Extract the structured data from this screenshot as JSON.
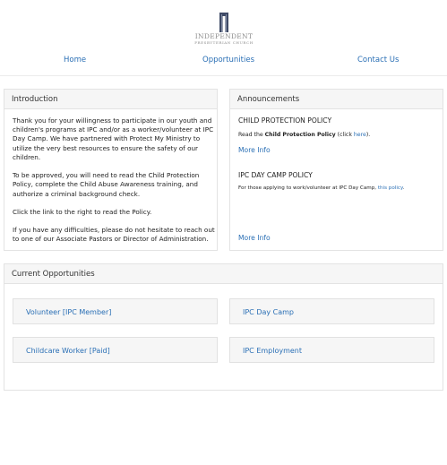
{
  "logo": {
    "name": "INDEPENDENT",
    "subtitle": "PRESBYTERIAN CHURCH",
    "icon": "church-tower-icon"
  },
  "nav": {
    "home": "Home",
    "opportunities": "Opportunities",
    "contact": "Contact Us"
  },
  "introduction": {
    "heading": "Introduction",
    "paragraphs": [
      "Thank you for your willingness to participate in our youth and children's programs at IPC and/or as a worker/volunteer at IPC Day Camp. We have partnered with Protect My Ministry to utilize the very best resources to ensure the safety of our children.",
      "To be approved, you will need to read the Child Protection Policy, complete the Child Abuse Awareness training, and authorize a criminal background check.",
      "Click the link to the right to read the Policy.",
      "If you have any difficulties, please do not hesitate to reach out to one of our Associate Pastors or Director of Administration."
    ]
  },
  "announcements": {
    "heading": "Announcements",
    "items": [
      {
        "title": "CHILD PROTECTION POLICY",
        "text_before": "Read the ",
        "bold": "Child Protection Policy",
        "text_mid": " (click ",
        "link": "here",
        "text_after": ").",
        "more": "More Info"
      },
      {
        "title": "IPC DAY CAMP POLICY",
        "text_before": "For those applying to work/volunteer at IPC Day Camp, ",
        "link": "this policy",
        "text_after": ".",
        "more": "More Info"
      }
    ]
  },
  "opportunities": {
    "heading": "Current Opportunities",
    "items": [
      "Volunteer [IPC Member]",
      "IPC Day Camp",
      "Childcare Worker [Paid]",
      "IPC Employment"
    ]
  },
  "colors": {
    "link": "#2a6fb5",
    "panel_header": "#f6f6f6",
    "border": "#e3e3e3"
  }
}
